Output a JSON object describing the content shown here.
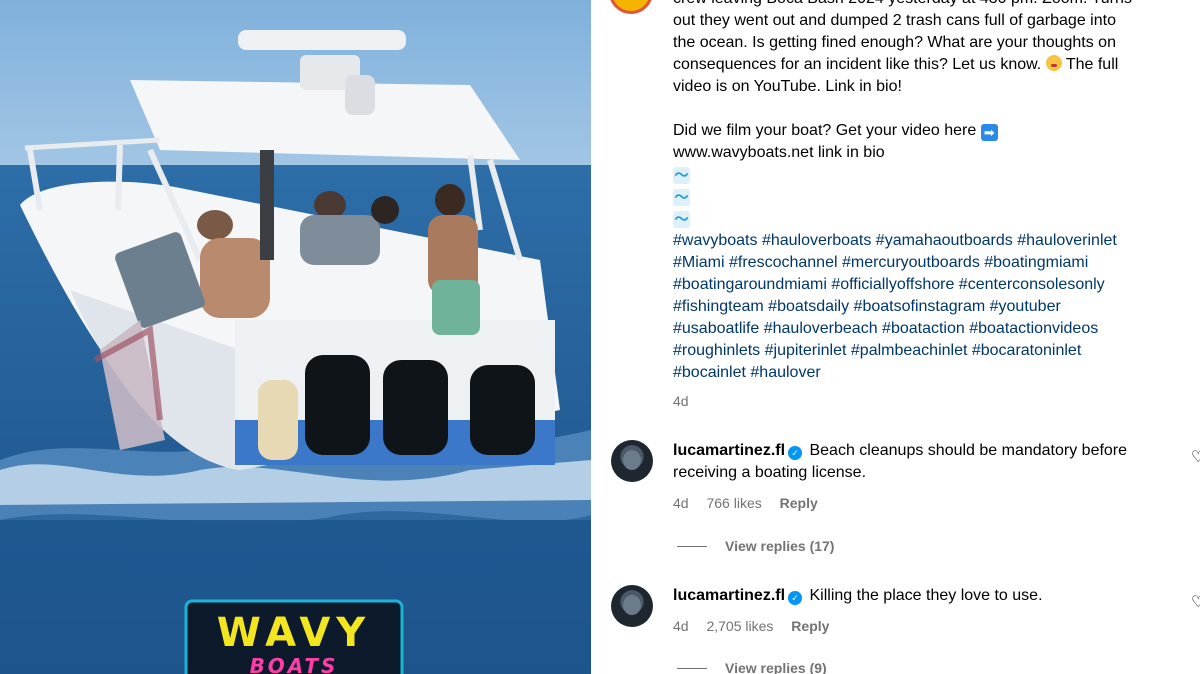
{
  "caption": {
    "lines": [
      "crew leaving Boca Bash 2024 yesterday at 430 pm. Zoom. Turns",
      "out they went out and dumped 2 trash cans full of garbage into",
      "the ocean. Is getting fined enough? What are your thoughts on",
      "consequences for an incident like this? Let us know.",
      "The full",
      "video is on YouTube. Link in bio!"
    ],
    "film_line": "Did we film your boat? Get your video here",
    "arrow_icon": "right-arrow-emoji",
    "site_line": "www.wavyboats.net link in bio",
    "waves": [
      "wave-emoji",
      "wave-emoji",
      "wave-emoji"
    ],
    "hashtag_lines": [
      "#wavyboats #hauloverboats #yamahaoutboards #hauloverinlet",
      "#Miami #frescochannel #mercuryoutboards #boatingmiami",
      "#boatingaroundmiami #officiallyoffshore #centerconsolesonly",
      "#fishingteam #boatsdaily #boatsofinstagram #youtuber",
      "#usaboatlife #hauloverbeach #boataction #boatactionvideos",
      "#roughinlets #jupiterinlet #palmbeachinlet #bocaratoninlet",
      "#bocainlet #haulover"
    ],
    "time": "4d"
  },
  "comments": [
    {
      "user": "lucamartinez.fl",
      "text_line1": "Beach cleanups should be mandatory before",
      "text_line2": "receiving a boating license.",
      "time": "4d",
      "likes": "766 likes",
      "reply": "Reply",
      "view_replies": "View replies (17)"
    },
    {
      "user": "lucamartinez.fl",
      "text_line1": "Killing the place they love to use.",
      "time": "4d",
      "likes": "2,705 likes",
      "reply": "Reply",
      "view_replies": "View replies (9)"
    }
  ],
  "media": {
    "logo_top": "WAVY",
    "logo_bottom": "BOATS"
  },
  "colors": {
    "link": "#00376b",
    "muted": "#737373",
    "verified": "#0095f6"
  }
}
